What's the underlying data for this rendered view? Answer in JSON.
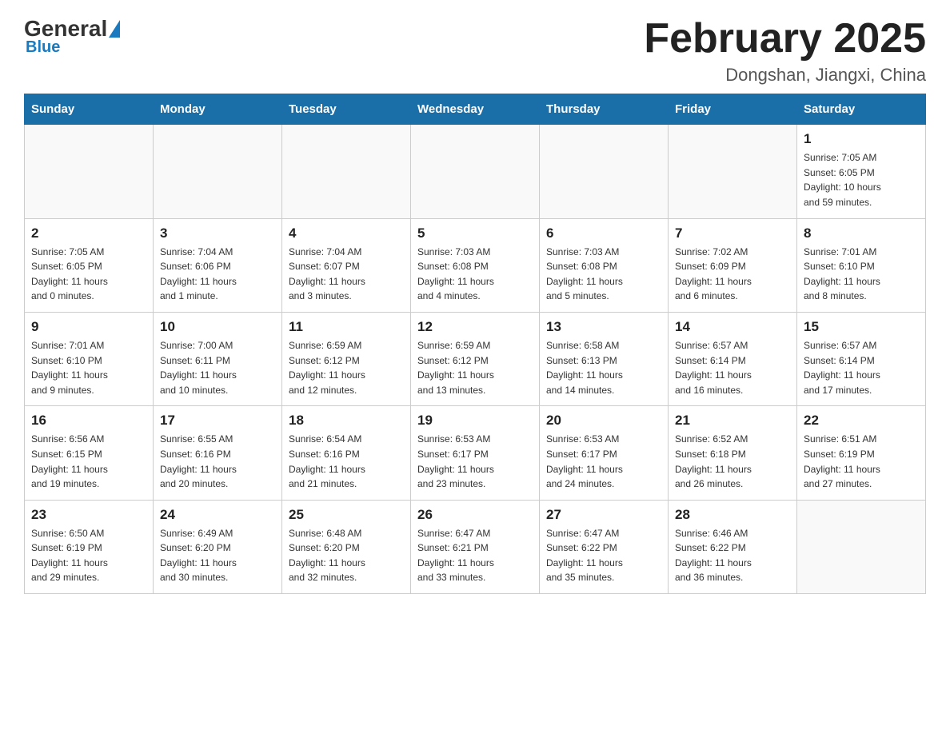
{
  "logo": {
    "general": "General",
    "blue": "Blue"
  },
  "title": "February 2025",
  "subtitle": "Dongshan, Jiangxi, China",
  "days_of_week": [
    "Sunday",
    "Monday",
    "Tuesday",
    "Wednesday",
    "Thursday",
    "Friday",
    "Saturday"
  ],
  "weeks": [
    [
      {
        "day": "",
        "info": ""
      },
      {
        "day": "",
        "info": ""
      },
      {
        "day": "",
        "info": ""
      },
      {
        "day": "",
        "info": ""
      },
      {
        "day": "",
        "info": ""
      },
      {
        "day": "",
        "info": ""
      },
      {
        "day": "1",
        "info": "Sunrise: 7:05 AM\nSunset: 6:05 PM\nDaylight: 10 hours\nand 59 minutes."
      }
    ],
    [
      {
        "day": "2",
        "info": "Sunrise: 7:05 AM\nSunset: 6:05 PM\nDaylight: 11 hours\nand 0 minutes."
      },
      {
        "day": "3",
        "info": "Sunrise: 7:04 AM\nSunset: 6:06 PM\nDaylight: 11 hours\nand 1 minute."
      },
      {
        "day": "4",
        "info": "Sunrise: 7:04 AM\nSunset: 6:07 PM\nDaylight: 11 hours\nand 3 minutes."
      },
      {
        "day": "5",
        "info": "Sunrise: 7:03 AM\nSunset: 6:08 PM\nDaylight: 11 hours\nand 4 minutes."
      },
      {
        "day": "6",
        "info": "Sunrise: 7:03 AM\nSunset: 6:08 PM\nDaylight: 11 hours\nand 5 minutes."
      },
      {
        "day": "7",
        "info": "Sunrise: 7:02 AM\nSunset: 6:09 PM\nDaylight: 11 hours\nand 6 minutes."
      },
      {
        "day": "8",
        "info": "Sunrise: 7:01 AM\nSunset: 6:10 PM\nDaylight: 11 hours\nand 8 minutes."
      }
    ],
    [
      {
        "day": "9",
        "info": "Sunrise: 7:01 AM\nSunset: 6:10 PM\nDaylight: 11 hours\nand 9 minutes."
      },
      {
        "day": "10",
        "info": "Sunrise: 7:00 AM\nSunset: 6:11 PM\nDaylight: 11 hours\nand 10 minutes."
      },
      {
        "day": "11",
        "info": "Sunrise: 6:59 AM\nSunset: 6:12 PM\nDaylight: 11 hours\nand 12 minutes."
      },
      {
        "day": "12",
        "info": "Sunrise: 6:59 AM\nSunset: 6:12 PM\nDaylight: 11 hours\nand 13 minutes."
      },
      {
        "day": "13",
        "info": "Sunrise: 6:58 AM\nSunset: 6:13 PM\nDaylight: 11 hours\nand 14 minutes."
      },
      {
        "day": "14",
        "info": "Sunrise: 6:57 AM\nSunset: 6:14 PM\nDaylight: 11 hours\nand 16 minutes."
      },
      {
        "day": "15",
        "info": "Sunrise: 6:57 AM\nSunset: 6:14 PM\nDaylight: 11 hours\nand 17 minutes."
      }
    ],
    [
      {
        "day": "16",
        "info": "Sunrise: 6:56 AM\nSunset: 6:15 PM\nDaylight: 11 hours\nand 19 minutes."
      },
      {
        "day": "17",
        "info": "Sunrise: 6:55 AM\nSunset: 6:16 PM\nDaylight: 11 hours\nand 20 minutes."
      },
      {
        "day": "18",
        "info": "Sunrise: 6:54 AM\nSunset: 6:16 PM\nDaylight: 11 hours\nand 21 minutes."
      },
      {
        "day": "19",
        "info": "Sunrise: 6:53 AM\nSunset: 6:17 PM\nDaylight: 11 hours\nand 23 minutes."
      },
      {
        "day": "20",
        "info": "Sunrise: 6:53 AM\nSunset: 6:17 PM\nDaylight: 11 hours\nand 24 minutes."
      },
      {
        "day": "21",
        "info": "Sunrise: 6:52 AM\nSunset: 6:18 PM\nDaylight: 11 hours\nand 26 minutes."
      },
      {
        "day": "22",
        "info": "Sunrise: 6:51 AM\nSunset: 6:19 PM\nDaylight: 11 hours\nand 27 minutes."
      }
    ],
    [
      {
        "day": "23",
        "info": "Sunrise: 6:50 AM\nSunset: 6:19 PM\nDaylight: 11 hours\nand 29 minutes."
      },
      {
        "day": "24",
        "info": "Sunrise: 6:49 AM\nSunset: 6:20 PM\nDaylight: 11 hours\nand 30 minutes."
      },
      {
        "day": "25",
        "info": "Sunrise: 6:48 AM\nSunset: 6:20 PM\nDaylight: 11 hours\nand 32 minutes."
      },
      {
        "day": "26",
        "info": "Sunrise: 6:47 AM\nSunset: 6:21 PM\nDaylight: 11 hours\nand 33 minutes."
      },
      {
        "day": "27",
        "info": "Sunrise: 6:47 AM\nSunset: 6:22 PM\nDaylight: 11 hours\nand 35 minutes."
      },
      {
        "day": "28",
        "info": "Sunrise: 6:46 AM\nSunset: 6:22 PM\nDaylight: 11 hours\nand 36 minutes."
      },
      {
        "day": "",
        "info": ""
      }
    ]
  ]
}
